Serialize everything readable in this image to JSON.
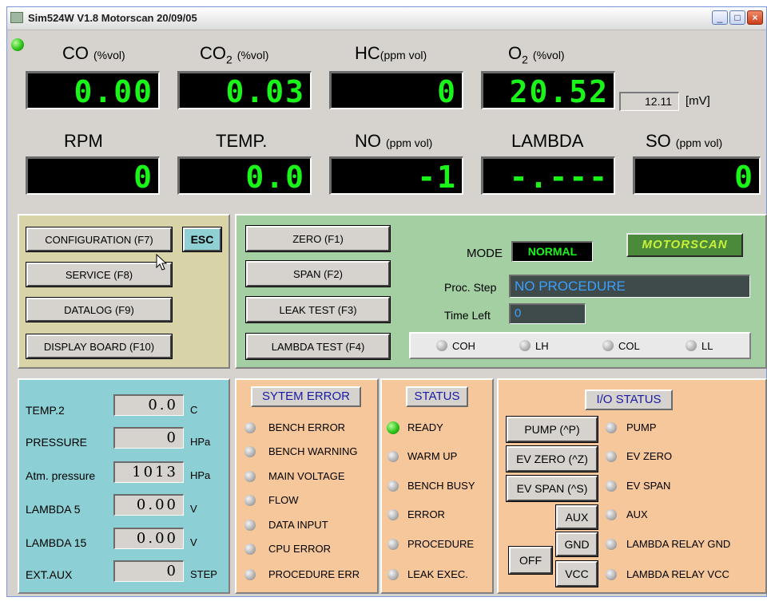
{
  "window": {
    "title": "Sim524W V1.8 Motorscan 20/09/05"
  },
  "measurements_row1": [
    {
      "name": "CO",
      "unit": "(%vol)",
      "value": "0.00"
    },
    {
      "name": "CO",
      "sub": "2",
      "unit": "(%vol)",
      "value": "0.03"
    },
    {
      "name": "HC",
      "unit": "(ppm vol)",
      "value": "0"
    },
    {
      "name": "O",
      "sub": "2",
      "unit": "(%vol)",
      "value": "20.52"
    }
  ],
  "o2_sensor": {
    "value": "12.11",
    "unit": "[mV]"
  },
  "measurements_row2": [
    {
      "name": "RPM",
      "unit": "",
      "value": "0"
    },
    {
      "name": "TEMP.",
      "unit": "",
      "value": "0.0"
    },
    {
      "name": "NO",
      "unit": "(ppm vol)",
      "value": "-1"
    },
    {
      "name": "LAMBDA",
      "unit": "",
      "value": "-.---"
    },
    {
      "name": "SO",
      "unit": "(ppm vol)",
      "value": "0"
    }
  ],
  "menu": {
    "configuration": "CONFIGURATION (F7)",
    "esc": "ESC",
    "service": "SERVICE (F8)",
    "datalog": "DATALOG (F9)",
    "display_board": "DISPLAY BOARD (F10)"
  },
  "procedures": {
    "zero": "ZERO (F1)",
    "span": "SPAN (F2)",
    "leak_test": "LEAK TEST (F3)",
    "lambda_test": "LAMBDA TEST (F4)",
    "mode_label": "MODE",
    "mode_value": "NORMAL",
    "logo": "MOTORSCAN",
    "proc_step_label": "Proc. Step",
    "proc_step_value": "NO PROCEDURE",
    "time_left_label": "Time Left",
    "time_left_value": "0",
    "indicators": [
      "COH",
      "LH",
      "COL",
      "LL"
    ]
  },
  "aux_readings": [
    {
      "label": "TEMP.2",
      "value": "0.0",
      "unit": "C"
    },
    {
      "label": "PRESSURE",
      "value": "0",
      "unit": "HPa"
    },
    {
      "label": "Atm. pressure",
      "value": "1013",
      "unit": "HPa"
    },
    {
      "label": "LAMBDA 5",
      "value": "0.00",
      "unit": "V"
    },
    {
      "label": "LAMBDA 15",
      "value": "0.00",
      "unit": "V"
    },
    {
      "label": "EXT.AUX",
      "value": "0",
      "unit": "STEP"
    }
  ],
  "system_error": {
    "title": "SYTEM ERROR",
    "items": [
      "BENCH ERROR",
      "BENCH WARNING",
      "MAIN VOLTAGE",
      "FLOW",
      "DATA INPUT",
      "CPU ERROR",
      "PROCEDURE ERR"
    ]
  },
  "status": {
    "title": "STATUS",
    "items": [
      "READY",
      "WARM UP",
      "BENCH BUSY",
      "ERROR",
      "PROCEDURE",
      "LEAK EXEC."
    ],
    "active": "READY"
  },
  "io_status": {
    "title": "I/O STATUS",
    "buttons": {
      "pump": "PUMP (^P)",
      "ev_zero": "EV ZERO (^Z)",
      "ev_span": "EV SPAN (^S)",
      "aux": "AUX",
      "gnd": "GND",
      "vcc": "VCC",
      "off": "OFF"
    },
    "items": [
      "PUMP",
      "EV ZERO",
      "EV SPAN",
      "AUX",
      "LAMBDA RELAY GND",
      "LAMBDA RELAY VCC"
    ]
  },
  "colors": {
    "display_text": "#19f519",
    "panel_yellow": "#d8d4a8",
    "panel_green": "#a3cfa3",
    "panel_teal": "#8ccfd4",
    "panel_orange": "#f5c79a"
  }
}
